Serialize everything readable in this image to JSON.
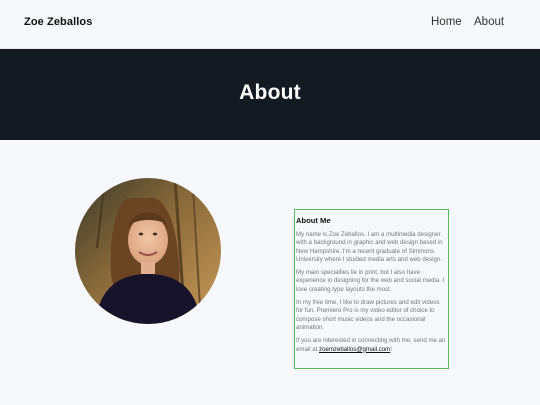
{
  "site": {
    "brand": "Zoe Zeballos"
  },
  "nav": {
    "items": [
      {
        "label": "Home"
      },
      {
        "label": "About"
      }
    ]
  },
  "hero": {
    "title": "About"
  },
  "about": {
    "heading": "About Me",
    "paragraphs": [
      "My name is Zoe Zeballos. I am a multimedia designer with a background in graphic and web design based in New Hampshire. I'm a recent graduate of Simmons University where I studied media arts and web design.",
      "My main specialties lie in print, but I also have experience in designing for the web and social media. I love creating type layouts the most.",
      "In my free time, I like to draw pictures and edit videos for fun. Premiere Pro is my video editor of choice to compose short music videos and the occasional animation."
    ],
    "contact_prefix": "If you are interested in connecting with me, send me an email at ",
    "email": "zoemzeballos@gmail.com",
    "contact_suffix": "!"
  },
  "colors": {
    "hero_bg": "#131a21",
    "page_bg": "#f7f8fb",
    "card_border": "#5cb85c",
    "body_text": "#777777"
  },
  "icons": {
    "avatar": "profile-photo"
  }
}
